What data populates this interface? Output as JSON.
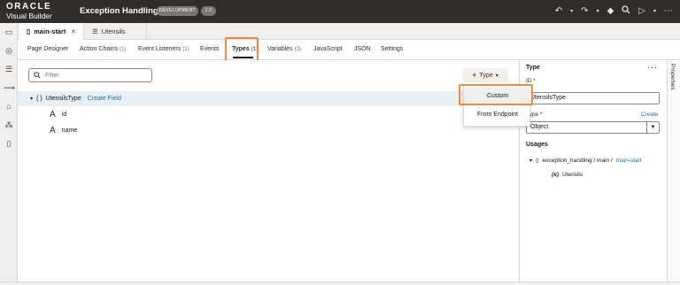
{
  "header": {
    "logo_top": "ORACLE",
    "logo_bottom": "Visual Builder",
    "app_title": "Exception Handling",
    "env_badge": "DEVELOPMENT",
    "version_badge": "1.0",
    "icons": [
      "undo-icon",
      "redo-icon",
      "diamond-icon",
      "search-icon",
      "play-icon"
    ]
  },
  "left_rail": {
    "icons": [
      "monitor-icon",
      "globe-icon",
      "database-icon",
      "flow-icon",
      "component-icon",
      "network-icon",
      "file-icon"
    ]
  },
  "file_tabs": [
    {
      "label": "main-start",
      "close": "×",
      "active": true
    },
    {
      "label": "Utensils",
      "active": false
    }
  ],
  "designer_tabs": [
    {
      "label": "Page Designer",
      "count": ""
    },
    {
      "label": "Action Chains",
      "count": "(1)"
    },
    {
      "label": "Event Listeners",
      "count": "(1)"
    },
    {
      "label": "Events",
      "count": ""
    },
    {
      "label": "Types",
      "count": "(1)"
    },
    {
      "label": "Variables",
      "count": "(3)"
    },
    {
      "label": "JavaScript",
      "count": ""
    },
    {
      "label": "JSON",
      "count": ""
    },
    {
      "label": "Settings",
      "count": ""
    }
  ],
  "main": {
    "filter_placeholder": "Filter",
    "add_type_label": "Type",
    "add_type_plus": "+",
    "type_name": "UtensilsType",
    "type_braces": "{ }",
    "create_field_label": "Create Field",
    "fields": [
      {
        "name": "id",
        "glyph": "A"
      },
      {
        "name": "name",
        "glyph": "A"
      }
    ]
  },
  "menu": {
    "items": [
      "Custom",
      "From Endpoint"
    ]
  },
  "properties": {
    "title": "Type",
    "more": "···",
    "id_label": "ID *",
    "id_value": "UtensilsType",
    "type_label": "Type *",
    "type_value": "Object",
    "create_label": "Create",
    "usages_label": "Usages",
    "usage_path": "exception_handling / main /",
    "usage_link": "main-start",
    "usage_var_prefix": "(x)",
    "usage_var_name": "Utensils",
    "rail_label": "Properties"
  },
  "colors": {
    "header_bg": "#312d2a",
    "highlight": "#f08a3c",
    "link": "#1a6fa8",
    "selected_row": "#e7f0f7"
  }
}
